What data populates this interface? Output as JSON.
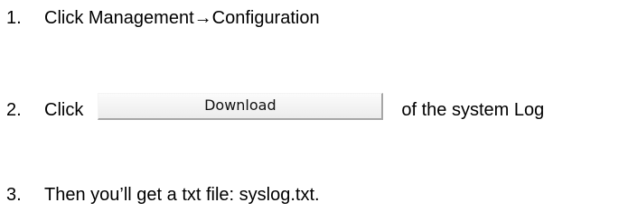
{
  "steps": [
    {
      "number": "1.",
      "text_before": "Click Management",
      "arrow_glyph": "→",
      "text_after": "Configuration"
    },
    {
      "number": "2.",
      "text_before": "Click",
      "button_label": "Download",
      "text_after": "of the system Log"
    },
    {
      "number": "3.",
      "text": "Then you’ll get a txt file: syslog.txt."
    }
  ],
  "colors": {
    "text": "#000000",
    "button_face": "#f3f3f3",
    "button_shadow": "#a6a6a6"
  }
}
